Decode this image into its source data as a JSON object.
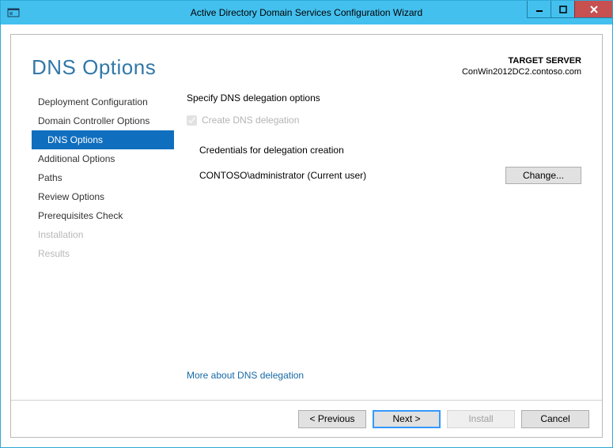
{
  "window": {
    "title": "Active Directory Domain Services Configuration Wizard"
  },
  "header": {
    "page_title": "DNS Options",
    "target_label": "TARGET SERVER",
    "target_value": "ConWin2012DC2.contoso.com"
  },
  "sidebar": {
    "items": [
      {
        "label": "Deployment Configuration",
        "state": "normal"
      },
      {
        "label": "Domain Controller Options",
        "state": "normal"
      },
      {
        "label": "DNS Options",
        "state": "active"
      },
      {
        "label": "Additional Options",
        "state": "normal"
      },
      {
        "label": "Paths",
        "state": "normal"
      },
      {
        "label": "Review Options",
        "state": "normal"
      },
      {
        "label": "Prerequisites Check",
        "state": "normal"
      },
      {
        "label": "Installation",
        "state": "disabled"
      },
      {
        "label": "Results",
        "state": "disabled"
      }
    ]
  },
  "main": {
    "section_text": "Specify DNS delegation options",
    "checkbox_label": "Create DNS delegation",
    "checkbox_checked": true,
    "checkbox_disabled": true,
    "credentials_label": "Credentials for delegation creation",
    "credentials_value": "CONTOSO\\administrator (Current user)",
    "change_button": "Change...",
    "more_link": "More about DNS delegation"
  },
  "footer": {
    "previous": "< Previous",
    "next": "Next >",
    "install": "Install",
    "cancel": "Cancel",
    "install_enabled": false
  }
}
